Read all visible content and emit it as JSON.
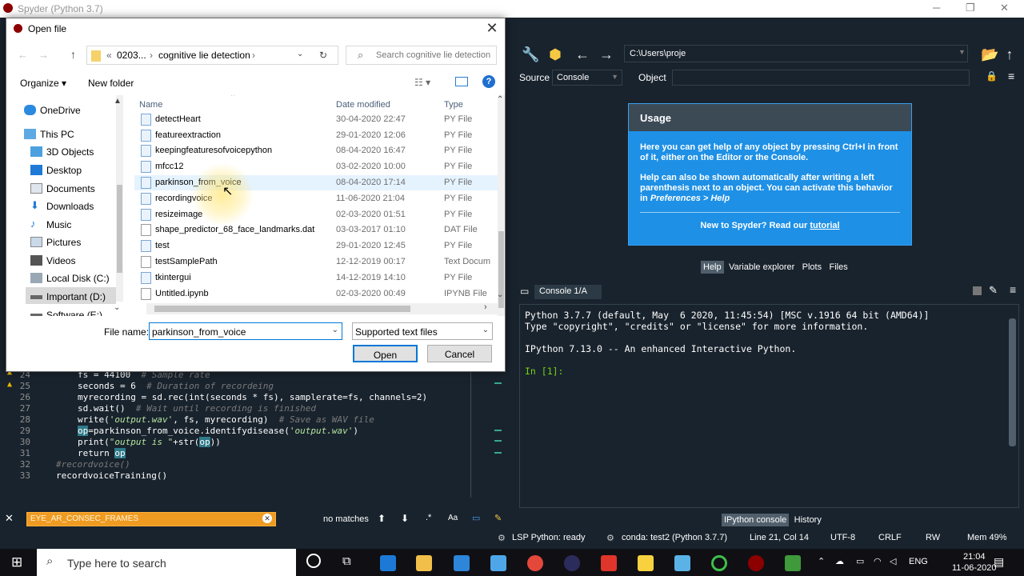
{
  "window": {
    "title": "Spyder (Python 3.7)"
  },
  "toolbar": {
    "path": "C:\\Users\\proje"
  },
  "help": {
    "source_label": "Source",
    "source_value": "Console",
    "object_label": "Object",
    "usage_title": "Usage",
    "usage_p1": "Here you can get help of any object by pressing Ctrl+I in front of it, either on the Editor or the Console.",
    "usage_p2a": "Help can also be shown automatically after writing a left parenthesis next to an object. You can activate this behavior in ",
    "usage_p2b": "Preferences > Help",
    "usage_p3a": "New to Spyder? Read our ",
    "usage_p3b": "tutorial",
    "tabs": [
      "Help",
      "Variable explorer",
      "Plots",
      "Files"
    ]
  },
  "console": {
    "tab": "Console 1/A",
    "line1": "Python 3.7.7 (default, May  6 2020, 11:45:54) [MSC v.1916 64 bit (AMD64)]",
    "line2": "Type \"copyright\", \"credits\" or \"license\" for more information.",
    "line3": "IPython 7.13.0 -- An enhanced Interactive Python.",
    "prompt": "In [1]:",
    "tabs": [
      "IPython console",
      "History"
    ]
  },
  "editor": {
    "lines": [
      {
        "n": "24",
        "code": "fs = 44100",
        "comment": "# Sample rate"
      },
      {
        "n": "25",
        "code": "seconds = 6",
        "comment": "# Duration of recordeing"
      },
      {
        "n": "26",
        "code": "myrecording = sd.rec(int(seconds * fs), samplerate=fs, channels=2)",
        "comment": ""
      },
      {
        "n": "27",
        "code": "sd.wait()",
        "comment": "# Wait until recording is finished"
      },
      {
        "n": "28",
        "code_a": "write(",
        "str": "'output.wav'",
        "code_b": ", fs, myrecording)",
        "comment": "# Save as WAV file"
      },
      {
        "n": "29",
        "hl": "op",
        "code_a": "=parkinson_from_voice.identifydisease(",
        "str": "'output.wav'",
        "code_b": ")"
      },
      {
        "n": "30",
        "code_a": "print(",
        "str": "\"output is \"",
        "code_b": "+str(",
        "hl": "op",
        "code_c": "))"
      },
      {
        "n": "31",
        "code_a": "return ",
        "hl": "op"
      },
      {
        "n": "32",
        "comment": "#recordvoice()"
      },
      {
        "n": "33",
        "code": "recordvoiceTraining()"
      }
    ]
  },
  "findbar": {
    "query": "EYE_AR_CONSEC_FRAMES",
    "status": "no matches",
    "case": "Aa"
  },
  "statusbar": {
    "lsp": "LSP Python: ready",
    "conda": "conda: test2 (Python 3.7.7)",
    "position": "Line 21, Col 14",
    "encoding": "UTF-8",
    "eol": "CRLF",
    "rw": "RW",
    "mem": "Mem 49%"
  },
  "taskbar": {
    "search_placeholder": "Type here to search",
    "lang": "ENG",
    "time": "21:04",
    "date": "11-06-2020"
  },
  "dialog": {
    "title": "Open file",
    "breadcrumb": [
      "«",
      "0203...",
      "›",
      "cognitive lie detection",
      "›"
    ],
    "search_placeholder": "Search cognitive lie detection",
    "organize": "Organize",
    "new_folder": "New folder",
    "nav": [
      "OneDrive",
      "This PC",
      "3D Objects",
      "Desktop",
      "Documents",
      "Downloads",
      "Music",
      "Pictures",
      "Videos",
      "Local Disk (C:)",
      "Important (D:)",
      "Software (E:)"
    ],
    "columns": {
      "name": "Name",
      "date": "Date modified",
      "type": "Type"
    },
    "files": [
      {
        "name": "detectHeart",
        "date": "30-04-2020 22:47",
        "type": "PY File"
      },
      {
        "name": "featureextraction",
        "date": "29-01-2020 12:06",
        "type": "PY File"
      },
      {
        "name": "keepingfeaturesofvoicepython",
        "date": "08-04-2020 16:47",
        "type": "PY File"
      },
      {
        "name": "mfcc12",
        "date": "03-02-2020 10:00",
        "type": "PY File"
      },
      {
        "name": "parkinson_from_voice",
        "date": "08-04-2020 17:14",
        "type": "PY File"
      },
      {
        "name": "recordingvoice",
        "date": "11-06-2020 21:04",
        "type": "PY File"
      },
      {
        "name": "resizeimage",
        "date": "02-03-2020 01:51",
        "type": "PY File"
      },
      {
        "name": "shape_predictor_68_face_landmarks.dat",
        "date": "03-03-2017 01:10",
        "type": "DAT File"
      },
      {
        "name": "test",
        "date": "29-01-2020 12:45",
        "type": "PY File"
      },
      {
        "name": "testSamplePath",
        "date": "12-12-2019 00:17",
        "type": "Text Docum"
      },
      {
        "name": "tkintergui",
        "date": "14-12-2019 14:10",
        "type": "PY File"
      },
      {
        "name": "Untitled.ipynb",
        "date": "02-03-2020 00:49",
        "type": "IPYNB File"
      }
    ],
    "filename_label": "File name:",
    "filename_value": "parkinson_from_voice",
    "filetype": "Supported text files",
    "open": "Open",
    "cancel": "Cancel"
  },
  "colors": {
    "accent": "#1e90e6",
    "console_bg": "#19232d",
    "find_orange": "#ef9b22",
    "dialog_focus": "#0078d7"
  }
}
